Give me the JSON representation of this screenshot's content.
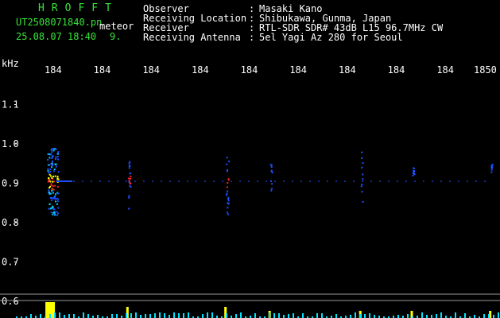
{
  "header": {
    "brand": "HROFFT",
    "file_name": "UT2508071840.pn",
    "mode": "meteor",
    "date_time": "25.08.07 18:40",
    "count": "9."
  },
  "station": {
    "rows": [
      {
        "label": "Observer",
        "value": "Masaki Kano"
      },
      {
        "label": "Receiving Location",
        "value": "Shibukawa, Gunma, Japan"
      },
      {
        "label": "Receiver",
        "value": "RTL-SDR SDR# 43dB L15 96.7MHz CW"
      },
      {
        "label": "Receiving Antenna",
        "value": "5el Yagi Az 280 for Seoul"
      }
    ]
  },
  "axes": {
    "y_unit": "kHz",
    "y_ticks": [
      "1.1",
      "1.0",
      "0.9",
      "0.8",
      "0.7",
      "0.6"
    ],
    "x_ticks": [
      "184",
      "184",
      "184",
      "184",
      "184",
      "184",
      "184",
      "184",
      "184",
      "1850"
    ]
  },
  "colors": {
    "text_green": "#37e637",
    "background": "#000000",
    "signal_core": "#ff2020",
    "signal_mid": "#ffff00",
    "signal_low": "#1e50ff",
    "histogram_bar": "#ffff00",
    "histogram_base": "#00e5ff",
    "divider": "#9a9a9a"
  },
  "chart_data": {
    "type": "heatmap",
    "ylabel": "kHz",
    "ylim": [
      0.6,
      1.15
    ],
    "x_tick_labels": [
      "184",
      "184",
      "184",
      "184",
      "184",
      "184",
      "184",
      "184",
      "184",
      "1850"
    ],
    "y_tick_labels": [
      "1.1",
      "1.0",
      "0.9",
      "0.8",
      "0.7",
      "0.6"
    ],
    "carrier_frequency_khz": 0.905,
    "echoes": [
      {
        "minute_index": 0.05,
        "freq_min": 0.82,
        "freq_max": 0.99,
        "intensity": "strong"
      },
      {
        "minute_index": 1.7,
        "freq_min": 0.83,
        "freq_max": 0.96,
        "intensity": "medium"
      },
      {
        "minute_index": 3.7,
        "freq_min": 0.82,
        "freq_max": 0.97,
        "intensity": "medium"
      },
      {
        "minute_index": 4.6,
        "freq_min": 0.88,
        "freq_max": 0.95,
        "intensity": "weak"
      },
      {
        "minute_index": 6.45,
        "freq_min": 0.85,
        "freq_max": 1.0,
        "intensity": "weak"
      },
      {
        "minute_index": 7.5,
        "freq_min": 0.92,
        "freq_max": 0.95,
        "intensity": "weak"
      },
      {
        "minute_index": 9.1,
        "freq_min": 0.93,
        "freq_max": 0.95,
        "intensity": "weak"
      }
    ]
  }
}
